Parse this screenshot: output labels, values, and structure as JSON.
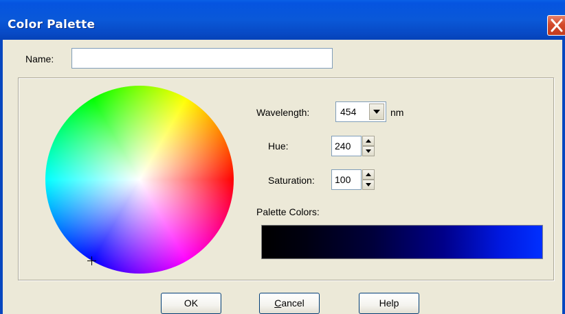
{
  "window": {
    "title": "Color Palette",
    "close_icon": "close-x-icon",
    "titlebar_color": "#0a58d8"
  },
  "name_field": {
    "label": "Name:",
    "value": ""
  },
  "wavelength": {
    "label": "Wavelength:",
    "value": "454",
    "unit": "nm"
  },
  "hue": {
    "label": "Hue:",
    "value": "240"
  },
  "saturation": {
    "label": "Saturation:",
    "value": "100"
  },
  "palette": {
    "label": "Palette Colors:",
    "gradient_start": "#000000",
    "gradient_end": "#0030ff"
  },
  "buttons": {
    "ok": "OK",
    "cancel": "Cancel",
    "help": "Help"
  },
  "icons": [
    "close-x-icon",
    "dropdown-arrow-icon",
    "spin-up-icon",
    "spin-down-icon",
    "crosshair-icon"
  ]
}
